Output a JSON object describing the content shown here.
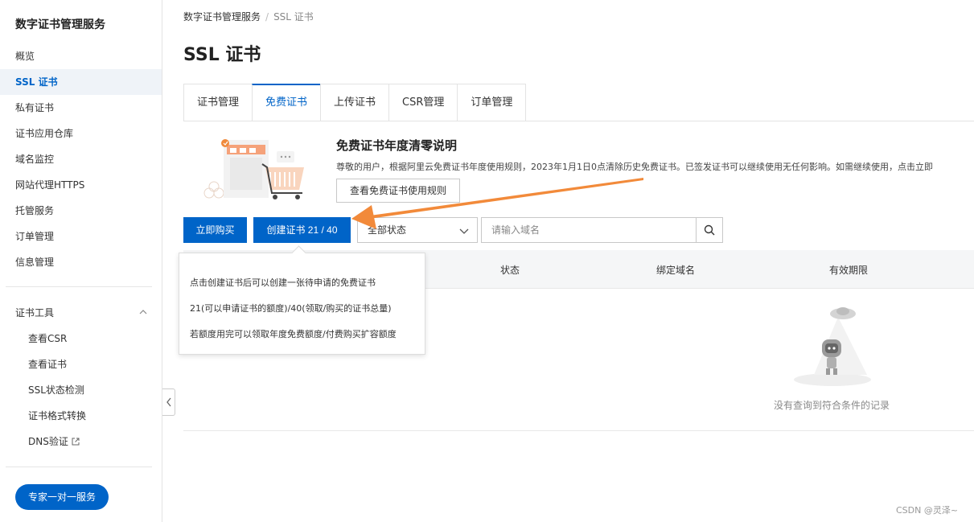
{
  "sidebar": {
    "title": "数字证书管理服务",
    "items": [
      "概览",
      "SSL 证书",
      "私有证书",
      "证书应用仓库",
      "域名监控",
      "网站代理HTTPS",
      "托管服务",
      "订单管理",
      "信息管理"
    ],
    "active_index": 1,
    "tools_group": {
      "label": "证书工具",
      "items": [
        "查看CSR",
        "查看证书",
        "SSL状态检测",
        "证书格式转换",
        "DNS验证"
      ]
    },
    "expert_button": "专家一对一服务"
  },
  "breadcrumb": {
    "root": "数字证书管理服务",
    "current": "SSL 证书"
  },
  "page_title": "SSL 证书",
  "tabs": [
    "证书管理",
    "免费证书",
    "上传证书",
    "CSR管理",
    "订单管理"
  ],
  "active_tab": 1,
  "notice": {
    "title": "免费证书年度清零说明",
    "text": "尊敬的用户，根据阿里云免费证书年度使用规则，2023年1月1日0点清除历史免费证书。已签发证书可以继续使用无任何影响。如需继续使用，点击立即",
    "button": "查看免费证书使用规则"
  },
  "toolbar": {
    "buy_button": "立即购买",
    "create_button": "创建证书 21 / 40",
    "status_select": "全部状态",
    "search_placeholder": "请输入域名"
  },
  "table": {
    "columns": [
      "状态",
      "绑定域名",
      "有效期限"
    ],
    "empty_text": "没有查询到符合条件的记录"
  },
  "tooltip": {
    "lines": [
      "点击创建证书后可以创建一张待申请的免费证书",
      "21(可以申请证书的额度)/40(领取/购买的证书总量)",
      "若额度用完可以领取年度免费额度/付费购买扩容额度"
    ]
  },
  "watermark": "CSDN @灵泽~",
  "colors": {
    "primary": "#0064c8",
    "arrow": "#f28a3a",
    "active_bg": "#eff3f8"
  }
}
